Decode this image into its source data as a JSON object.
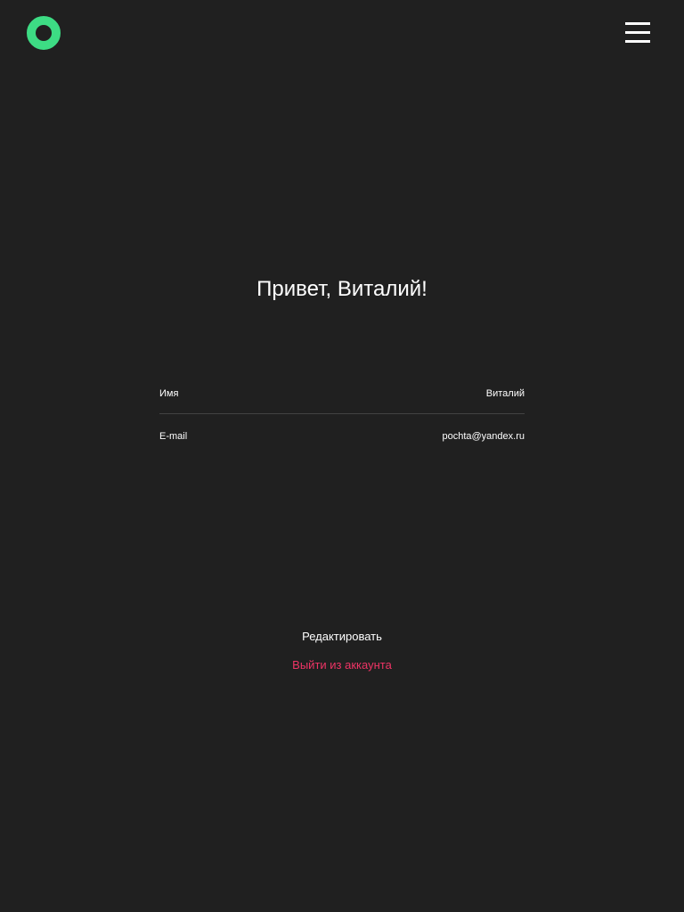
{
  "header": {
    "logo_icon": "ring-logo-icon",
    "logo_color": "#3ddc84",
    "menu_icon": "hamburger-menu-icon"
  },
  "profile": {
    "greeting": "Привет, Виталий!",
    "fields": [
      {
        "label": "Имя",
        "value": "Виталий"
      },
      {
        "label": "E-mail",
        "value": "pochta@yandex.ru"
      }
    ]
  },
  "actions": {
    "edit_label": "Редактировать",
    "logout_label": "Выйти из аккаунта",
    "logout_color": "#ee3465"
  },
  "colors": {
    "background": "#202020",
    "text": "#ffffff",
    "divider": "#424242"
  }
}
